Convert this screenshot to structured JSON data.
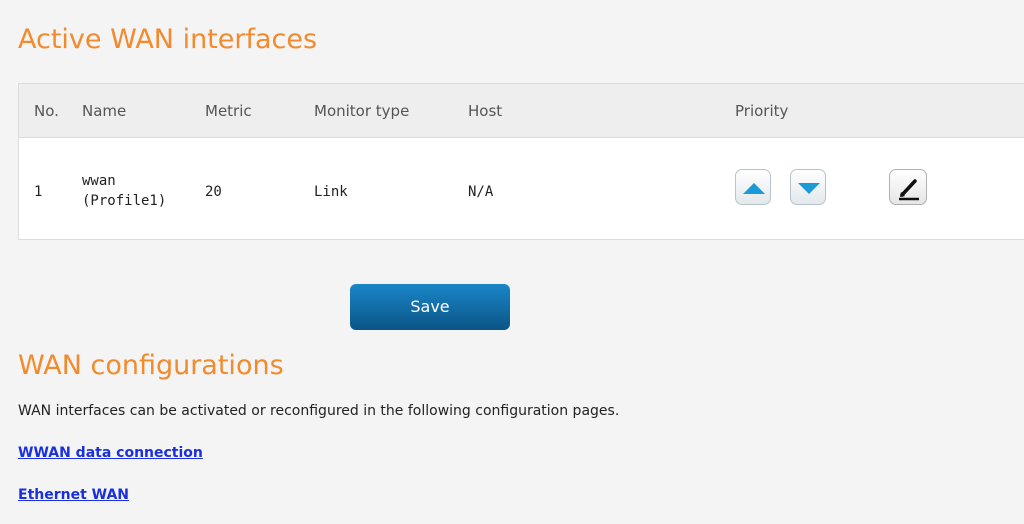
{
  "active_section": {
    "title": "Active WAN interfaces"
  },
  "table": {
    "headers": {
      "no": "No.",
      "name": "Name",
      "metric": "Metric",
      "monitor_type": "Monitor type",
      "host": "Host",
      "priority": "Priority"
    },
    "rows": [
      {
        "no": "1",
        "name_line1": "wwan",
        "name_line2": "(Profile1)",
        "metric": "20",
        "monitor_type": "Link",
        "host": "N/A"
      }
    ]
  },
  "icons": {
    "move_up": "arrow-up-icon",
    "move_down": "arrow-down-icon",
    "edit": "pencil-icon"
  },
  "save_button": {
    "label": "Save"
  },
  "config_section": {
    "title": "WAN configurations",
    "description": "WAN interfaces can be activated or reconfigured in the following configuration pages.",
    "links": [
      "WWAN data connection",
      "Ethernet WAN"
    ]
  },
  "colors": {
    "title_orange": "#f28a2e",
    "save_blue": "#0b5587",
    "arrow_blue": "#1a9ad6",
    "link_blue": "#1a2fe0"
  }
}
